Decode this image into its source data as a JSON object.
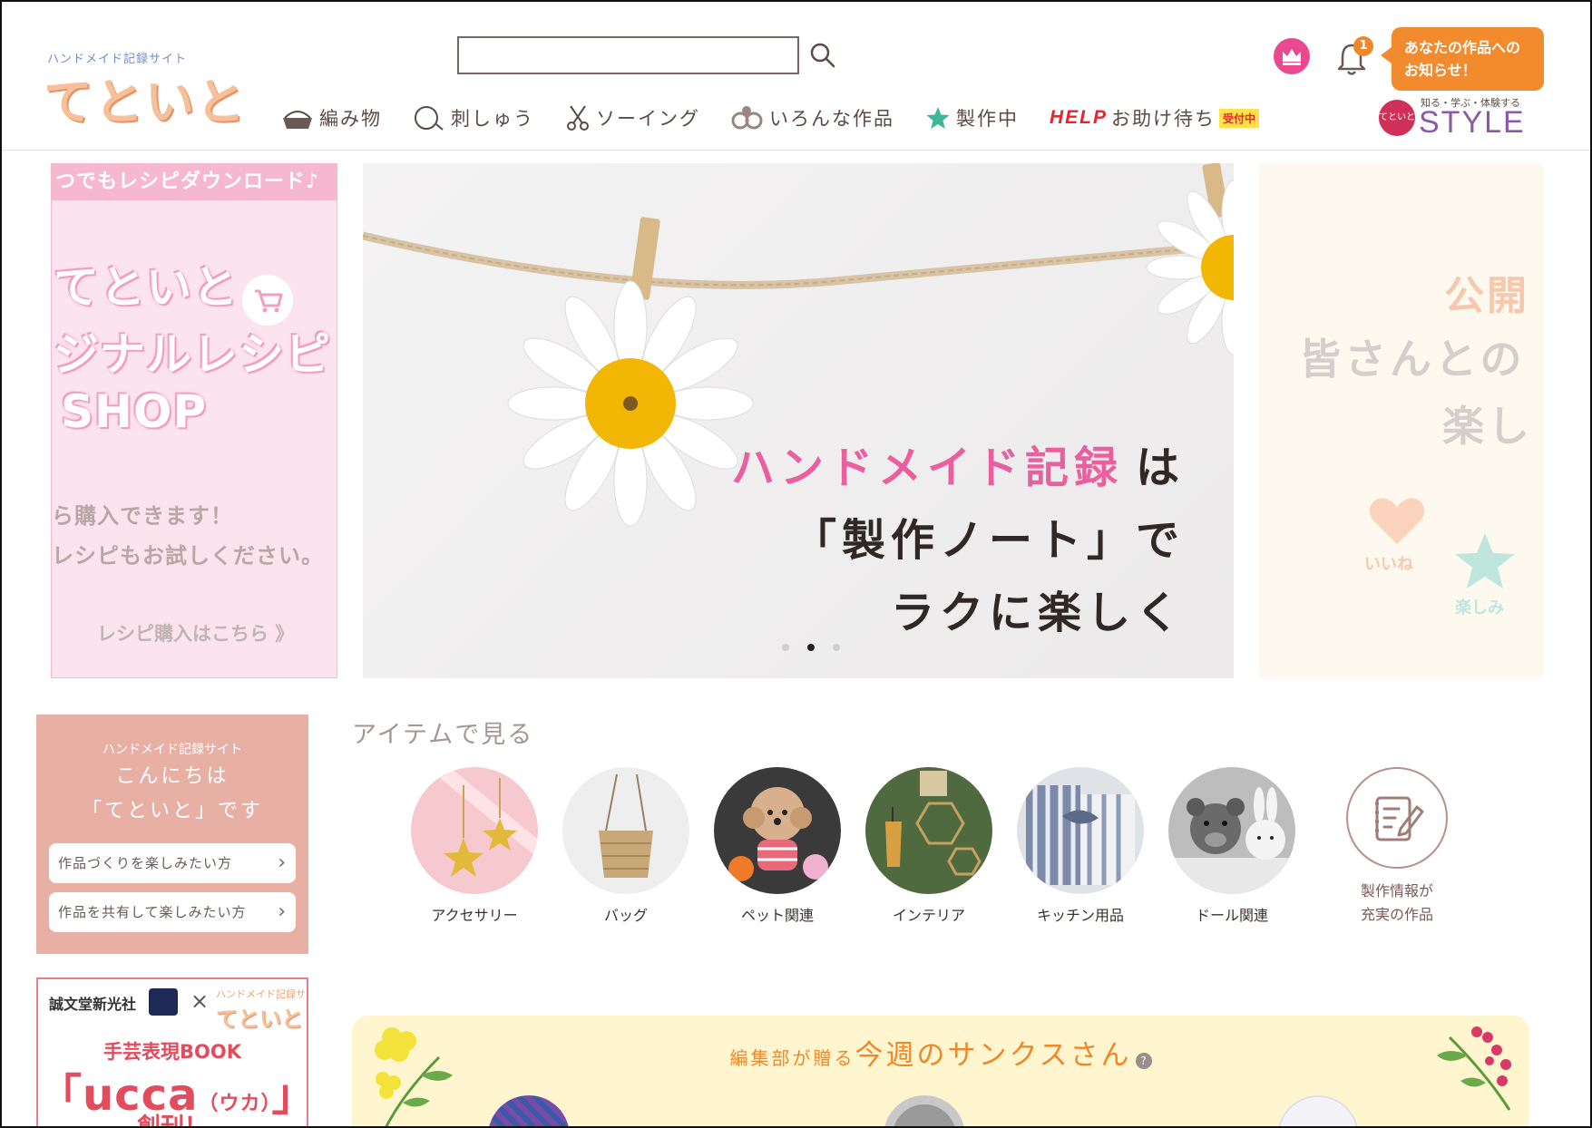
{
  "header": {
    "logo_sub": "ハンドメイド記録サイト",
    "logo_main": "てといと",
    "search": {
      "placeholder": "",
      "value": ""
    },
    "bell_count": "1",
    "notice": "あなたの作品へのお知らせ！",
    "style_logo": {
      "top": "知る・学ぶ・体験する",
      "dot": "てといと",
      "word": "STYLE"
    },
    "nav": [
      {
        "label": "編み物",
        "icon": "basket-icon"
      },
      {
        "label": "刺しゅう",
        "icon": "embroidery-hoop-icon"
      },
      {
        "label": "ソーイング",
        "icon": "scissors-icon"
      },
      {
        "label": "いろんな作品",
        "icon": "misc-works-icon"
      },
      {
        "label": "製作中",
        "icon": "star-icon"
      },
      {
        "label": "お助け待ち",
        "help": "HELP",
        "badge": "受付中"
      }
    ]
  },
  "carousel": {
    "left": {
      "bar": "つでもレシピダウンロード♪",
      "big1": "てといと",
      "big2": "ジナルレシピ",
      "big3": "SHOP",
      "small1": "ら購入できます！",
      "small2": "レシピもお試しください。",
      "link": "レシピ購入はこちら 》"
    },
    "main": {
      "line1_pink": "ハンドメイド記録",
      "line1_rest": "は",
      "line2": "「製作ノート」で",
      "line3": "ラクに楽しく"
    },
    "right": {
      "orange": "公開",
      "gray1": "皆さんとの",
      "gray2": "楽し",
      "like": "いいね",
      "fun": "楽しみ"
    },
    "dots": 3,
    "active_dot": 1
  },
  "welcome": {
    "sub": "ハンドメイド記録サイト",
    "line1": "こんにちは",
    "line2": "「てといと」です",
    "btn1": "作品づくりを楽しみたい方",
    "btn2": "作品を共有して楽しみたい方"
  },
  "ucca": {
    "publisher": "誠文堂新光社",
    "x": "×",
    "logo_sub": "ハンドメイド記録サイト",
    "logo_main": "てといと",
    "t1": "手芸表現BOOK",
    "t2_main": "「ucca",
    "t2_small": "（ウカ）",
    "t2_end": "」",
    "t3": "創刊！"
  },
  "items": {
    "title": "アイテムで見る",
    "list": [
      {
        "label": "アクセサリー"
      },
      {
        "label": "バッグ"
      },
      {
        "label": "ペット関連"
      },
      {
        "label": "インテリア"
      },
      {
        "label": "キッチン用品"
      },
      {
        "label": "ドール関連"
      }
    ],
    "note_line1": "製作情報が",
    "note_line2": "充実の作品"
  },
  "thanks": {
    "pre": "編集部が贈る",
    "main": "今週のサンクスさん",
    "q": "?"
  },
  "colors": {
    "accent_orange": "#f28a2e",
    "pink": "#e9609f",
    "crown": "#e9498f",
    "text": "#5a4a45"
  }
}
